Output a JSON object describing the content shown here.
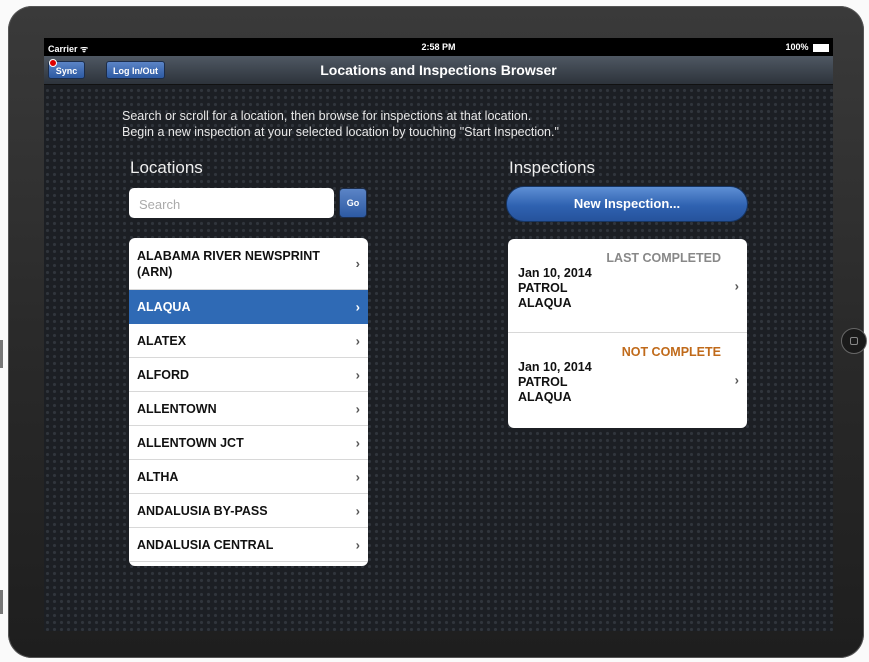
{
  "statusbar": {
    "carrier": "Carrier ᯤ",
    "time": "2:58 PM",
    "battery": "100%"
  },
  "navbar": {
    "title": "Locations and Inspections Browser",
    "sync_label": "Sync",
    "login_label": "Log In/Out"
  },
  "instructions": {
    "line1": "Search or scroll for a location, then browse for inspections at that location.",
    "line2": "Begin a new inspection at your selected location by touching \"Start Inspection.\""
  },
  "locations": {
    "heading": "Locations",
    "search_placeholder": "Search",
    "go_label": "Go",
    "items": [
      {
        "label": "ALABAMA RIVER NEWSPRINT (ARN)"
      },
      {
        "label": "ALAQUA",
        "selected": true
      },
      {
        "label": "ALATEX"
      },
      {
        "label": "ALFORD"
      },
      {
        "label": "ALLENTOWN"
      },
      {
        "label": "ALLENTOWN JCT"
      },
      {
        "label": "ALTHA"
      },
      {
        "label": "ANDALUSIA BY-PASS"
      },
      {
        "label": "ANDALUSIA CENTRAL"
      }
    ]
  },
  "inspections": {
    "heading": "Inspections",
    "new_label": "New Inspection...",
    "items": [
      {
        "status": "LAST COMPLETED",
        "date": "Jan 10, 2014",
        "type": "PATROL",
        "location": "ALAQUA"
      },
      {
        "status": "NOT COMPLETE",
        "date": "Jan 10, 2014",
        "type": "PATROL",
        "location": "ALAQUA"
      }
    ]
  },
  "colors": {
    "accent": "#2f6ab5",
    "not_complete": "#c06a1a",
    "completed": "#888888"
  },
  "icons": {
    "chevron": "chevron-right-icon",
    "wifi": "wifi-icon",
    "battery": "battery-icon",
    "home": "home-button-icon"
  }
}
